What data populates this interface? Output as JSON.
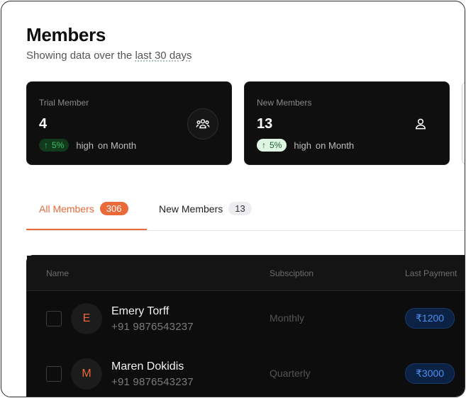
{
  "header": {
    "title": "Members",
    "subtitle_prefix": "Showing data over the",
    "subtitle_link": "last 30 days"
  },
  "stats": [
    {
      "label": "Trial Member",
      "value": "4",
      "trend_pct": "5%",
      "trend_word": "high",
      "trend_period": "on Month",
      "icon": "users-group-icon"
    },
    {
      "label": "New Members",
      "value": "13",
      "trend_pct": "5%",
      "trend_word": "high",
      "trend_period": "on Month",
      "icon": "user-icon"
    }
  ],
  "tabs": [
    {
      "label": "All Members",
      "count": "306",
      "active": true
    },
    {
      "label": "New Members",
      "count": "13",
      "active": false
    }
  ],
  "table": {
    "columns": [
      "Name",
      "Subsciption",
      "Last Payment"
    ],
    "rows": [
      {
        "initial": "E",
        "name": "Emery Torff",
        "phone": "+91 9876543237",
        "subscription": "Monthly",
        "payment": "₹1200"
      },
      {
        "initial": "M",
        "name": "Maren Dokidis",
        "phone": "+91 9876543237",
        "subscription": "Quarterly",
        "payment": "₹3000"
      }
    ]
  },
  "colors": {
    "accent": "#ea6a3a",
    "card_bg": "#0f0f0f",
    "trend_green": "#38c060",
    "payment_blue": "#4e8ff0"
  }
}
